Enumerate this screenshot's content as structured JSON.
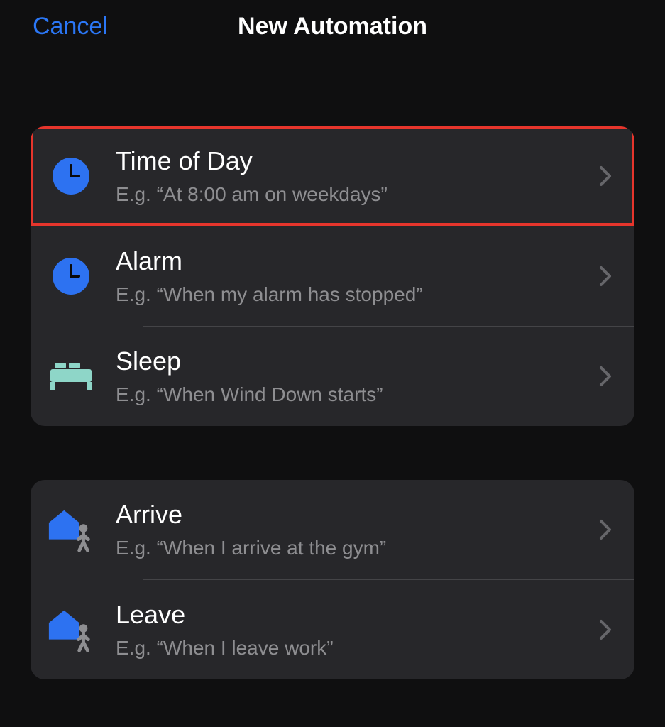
{
  "nav": {
    "cancel": "Cancel",
    "title": "New Automation"
  },
  "groups": [
    {
      "rows": [
        {
          "icon": "clock",
          "title": "Time of Day",
          "sub": "E.g. “At 8:00 am on weekdays”",
          "highlighted": true
        },
        {
          "icon": "clock",
          "title": "Alarm",
          "sub": "E.g. “When my alarm has stopped”",
          "highlighted": false
        },
        {
          "icon": "bed",
          "title": "Sleep",
          "sub": "E.g. “When Wind Down starts”",
          "highlighted": false
        }
      ]
    },
    {
      "rows": [
        {
          "icon": "house-person",
          "title": "Arrive",
          "sub": "E.g. “When I arrive at the gym”",
          "highlighted": false
        },
        {
          "icon": "house-person",
          "title": "Leave",
          "sub": "E.g. “When I leave work”",
          "highlighted": false
        }
      ]
    }
  ],
  "colors": {
    "accentBlue": "#2d72f1",
    "bedTeal": "#8ed6c8",
    "personGray": "#8e8e91"
  }
}
